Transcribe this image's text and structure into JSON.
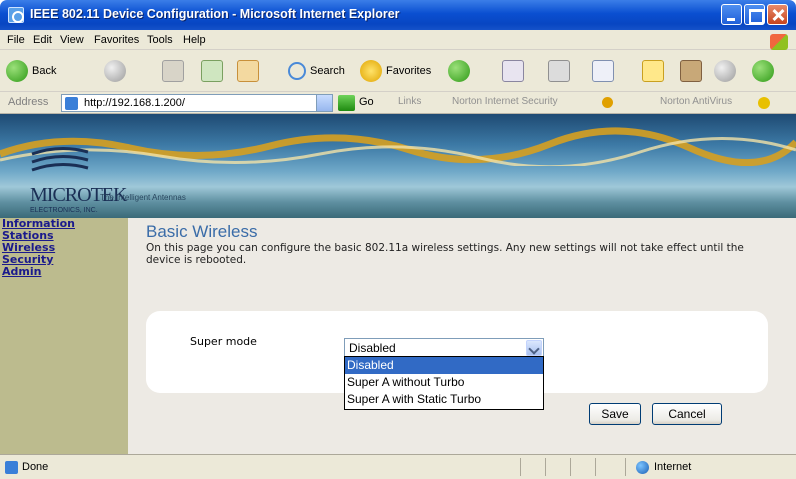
{
  "window": {
    "title": "IEEE 802.11 Device Configuration - Microsoft Internet Explorer"
  },
  "menu": [
    "File",
    "Edit",
    "View",
    "Favorites",
    "Tools",
    "Help"
  ],
  "toolbar": {
    "back": "Back",
    "search": "Search",
    "favorites": "Favorites"
  },
  "address": {
    "label": "Address",
    "url": "http://192.168.1.200/",
    "go": "Go",
    "links": "Links",
    "norton_security": "Norton Internet Security",
    "norton_antivirus": "Norton AntiVirus"
  },
  "banner": {
    "logo": "MICROTEK",
    "sub": "ELECTRONICS, INC.",
    "tagline": "The Intelligent Antennas"
  },
  "sidebar": {
    "items": [
      "Information",
      "Stations",
      "Wireless",
      "Security",
      "Admin"
    ]
  },
  "page": {
    "title": "Basic Wireless",
    "description": "On this page you can configure the basic 802.11a wireless settings. Any new settings will not take effect until the device is rebooted.",
    "super_mode_label": "Super mode",
    "super_mode_value": "Disabled",
    "options": [
      "Disabled",
      "Super A without Turbo",
      "Super A with Static Turbo"
    ],
    "save": "Save",
    "cancel": "Cancel"
  },
  "status": {
    "text": "Done",
    "zone": "Internet"
  },
  "colors": {
    "title_blue": "#3a6ca8",
    "sidebar_bg": "#bcbb8e",
    "link": "#1a1a8c",
    "selection": "#316ac5"
  }
}
